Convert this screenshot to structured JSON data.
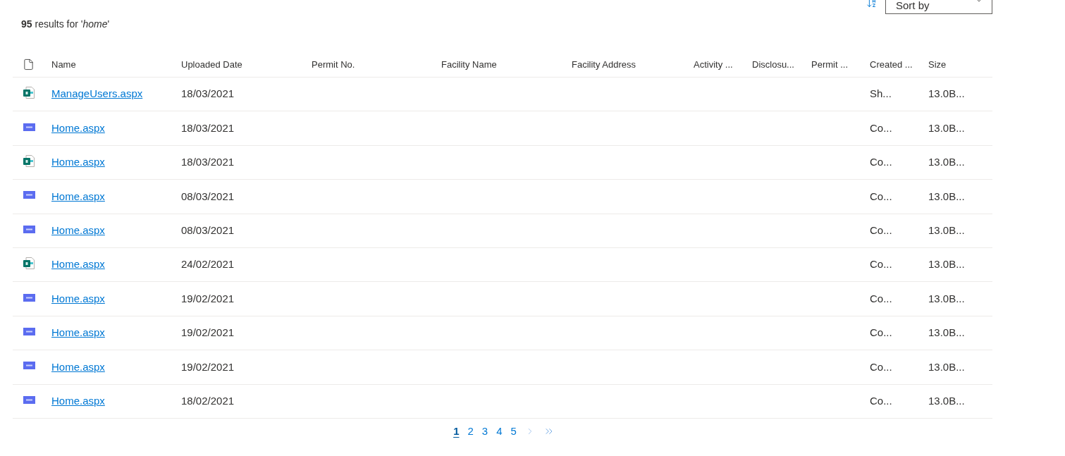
{
  "sort": {
    "placeholder": "Sort by"
  },
  "results_heading": "**95** results for '*home*'",
  "table": {
    "columns": [
      "Name",
      "Uploaded Date",
      "Permit No.",
      "Facility Name",
      "Facility Address",
      "Activity ...",
      "Disclosu...",
      "Permit ...",
      "Created ...",
      "Size"
    ],
    "rows": [
      {
        "kind": "sharepoint",
        "name": "ManageUsers.aspx",
        "uploaded_date": "18/03/2021",
        "created": "Sh...",
        "size": "13.0B..."
      },
      {
        "kind": "dms",
        "name": "Home.aspx",
        "uploaded_date": "18/03/2021",
        "created": "Co...",
        "size": "13.0B..."
      },
      {
        "kind": "sharepoint",
        "name": "Home.aspx",
        "uploaded_date": "18/03/2021",
        "created": "Co...",
        "size": "13.0B..."
      },
      {
        "kind": "dms",
        "name": "Home.aspx",
        "uploaded_date": "08/03/2021",
        "created": "Co...",
        "size": "13.0B..."
      },
      {
        "kind": "dms",
        "name": "Home.aspx",
        "uploaded_date": "08/03/2021",
        "created": "Co...",
        "size": "13.0B..."
      },
      {
        "kind": "sharepoint",
        "name": "Home.aspx",
        "uploaded_date": "24/02/2021",
        "created": "Co...",
        "size": "13.0B..."
      },
      {
        "kind": "dms",
        "name": "Home.aspx",
        "uploaded_date": "19/02/2021",
        "created": "Co...",
        "size": "13.0B..."
      },
      {
        "kind": "dms",
        "name": "Home.aspx",
        "uploaded_date": "19/02/2021",
        "created": "Co...",
        "size": "13.0B..."
      },
      {
        "kind": "dms",
        "name": "Home.aspx",
        "uploaded_date": "19/02/2021",
        "created": "Co...",
        "size": "13.0B..."
      },
      {
        "kind": "dms",
        "name": "Home.aspx",
        "uploaded_date": "18/02/2021",
        "created": "Co...",
        "size": "13.0B..."
      }
    ]
  },
  "pagination": {
    "pages": [
      {
        "label": "1",
        "selected": true
      },
      {
        "label": "2",
        "selected": false
      },
      {
        "label": "3",
        "selected": false
      },
      {
        "label": "4",
        "selected": false
      },
      {
        "label": "5",
        "selected": false
      }
    ]
  }
}
